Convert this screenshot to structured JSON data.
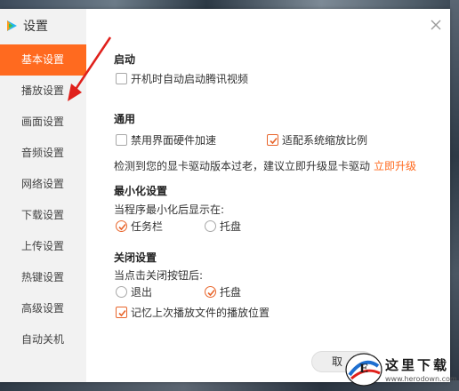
{
  "window": {
    "title": "设置"
  },
  "sidebar": {
    "items": [
      {
        "label": "基本设置",
        "active": true
      },
      {
        "label": "播放设置",
        "active": false
      },
      {
        "label": "画面设置",
        "active": false
      },
      {
        "label": "音频设置",
        "active": false
      },
      {
        "label": "网络设置",
        "active": false
      },
      {
        "label": "下载设置",
        "active": false
      },
      {
        "label": "上传设置",
        "active": false
      },
      {
        "label": "热键设置",
        "active": false
      },
      {
        "label": "高级设置",
        "active": false
      },
      {
        "label": "自动关机",
        "active": false
      }
    ]
  },
  "startup": {
    "title": "启动",
    "auto_start": {
      "label": "开机时自动启动腾讯视频",
      "checked": false
    }
  },
  "general": {
    "title": "通用",
    "disable_hw": {
      "label": "禁用界面硬件加速",
      "checked": false
    },
    "adapt_scale": {
      "label": "适配系统缩放比例",
      "checked": true
    },
    "driver_notice": "检测到您的显卡驱动版本过老，建议立即升级显卡驱动",
    "upgrade_link": "立即升级"
  },
  "minimize": {
    "title": "最小化设置",
    "prompt": "当程序最小化后显示在:",
    "options": [
      {
        "label": "任务栏",
        "checked": true
      },
      {
        "label": "托盘",
        "checked": false
      }
    ]
  },
  "close": {
    "title": "关闭设置",
    "prompt": "当点击关闭按钮后:",
    "options": [
      {
        "label": "退出",
        "checked": false
      },
      {
        "label": "托盘",
        "checked": true
      }
    ],
    "remember_pos": {
      "label": "记忆上次播放文件的播放位置",
      "checked": true
    }
  },
  "footer": {
    "confirm_label": "取"
  },
  "watermark": {
    "text": "这里下载",
    "url": "www.herodown.com"
  },
  "colors": {
    "accent": "#ff6a1f",
    "check": "#e8652b",
    "annotation_arrow": "#e0201b"
  }
}
